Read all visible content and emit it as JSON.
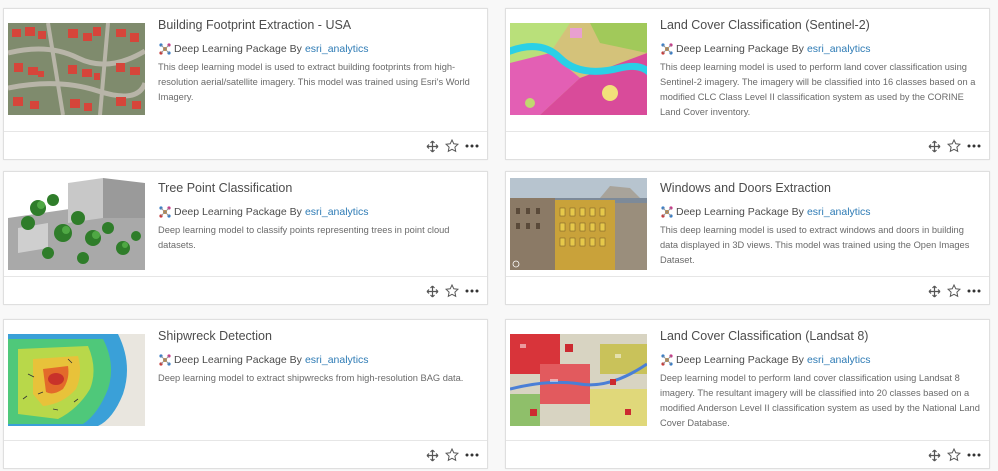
{
  "items": [
    {
      "title": "Building Footprint Extraction - USA",
      "type": "Deep Learning Package",
      "by": "By",
      "owner": "esri_analytics",
      "description": "This deep learning model is used to extract building footprints from high-resolution aerial/satellite imagery. This model was trained using Esri's World Imagery.",
      "thumbnail": "building-footprints-thumbnail"
    },
    {
      "title": "Land Cover Classification (Sentinel-2)",
      "type": "Deep Learning Package",
      "by": "By",
      "owner": "esri_analytics",
      "description": "This deep learning model is used to perform land cover classification using Sentinel-2 imagery. The imagery will be classified into 16 classes based on a modified CLC Class Level II classification system as used by the CORINE Land Cover inventory.",
      "thumbnail": "sentinel-landcover-thumbnail"
    },
    {
      "title": "Tree Point Classification",
      "type": "Deep Learning Package",
      "by": "By",
      "owner": "esri_analytics",
      "description": "Deep learning model to classify points representing trees in point cloud datasets.",
      "thumbnail": "tree-points-thumbnail"
    },
    {
      "title": "Windows and Doors Extraction",
      "type": "Deep Learning Package",
      "by": "By",
      "owner": "esri_analytics",
      "description": "This deep learning model is used to extract windows and doors in building data displayed in 3D views. This model was trained using the Open Images Dataset.",
      "thumbnail": "windows-doors-thumbnail"
    },
    {
      "title": "Shipwreck Detection",
      "type": "Deep Learning Package",
      "by": "By",
      "owner": "esri_analytics",
      "description": "Deep learning model to extract shipwrecks from high-resolution BAG data.",
      "thumbnail": "shipwreck-bathymetry-thumbnail"
    },
    {
      "title": "Land Cover Classification (Landsat 8)",
      "type": "Deep Learning Package",
      "by": "By",
      "owner": "esri_analytics",
      "description": "Deep learning model to perform land cover classification using Landsat 8 imagery. The resultant imagery will be classified into 20 classes based on a modified Anderson Level II classification system as used by the National Land Cover Database.",
      "thumbnail": "landsat-landcover-thumbnail"
    }
  ],
  "icons": {
    "type": "deep-learning-package-icon",
    "open_in": "open-in-app-icon",
    "favorite": "star-icon",
    "more": "more-options-icon"
  },
  "colors": {
    "link": "#2e7bb5",
    "border": "#dfdfdf",
    "text": "#4c4c4c"
  }
}
